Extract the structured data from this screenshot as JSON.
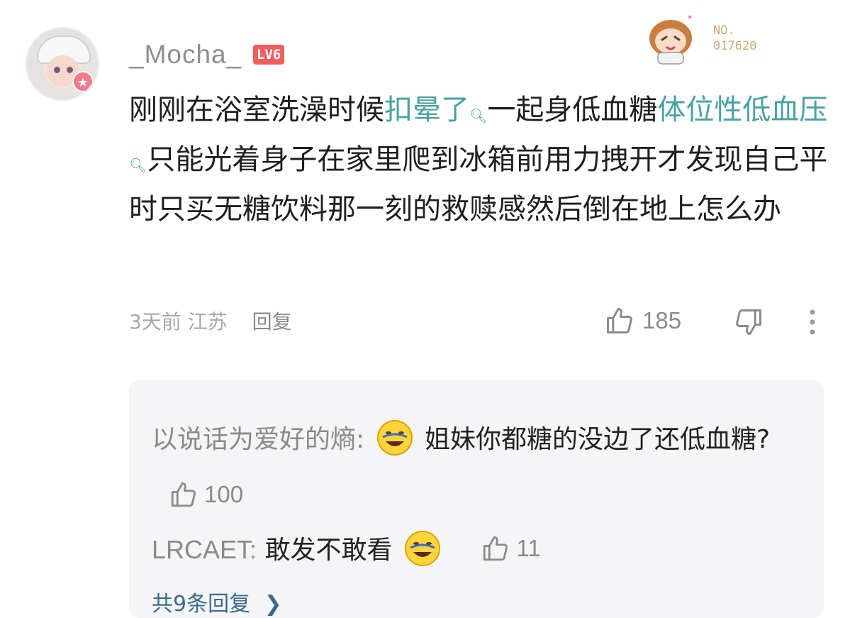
{
  "comment": {
    "username": "_Mocha_",
    "level": "LV6",
    "serial_line1": "NO.",
    "serial_line2": "017620",
    "text_part1": "刚刚在浴室洗澡时候",
    "keyword1": "扣晕了",
    "text_part2": "一起身低血糖",
    "keyword2": "体位性低血压",
    "text_part3": "只能光着身子在家里爬到冰箱前用力拽开才发现自己平时只买无糖饮料那一刻的救赎感然后倒在地上怎么办",
    "time": "3天前",
    "location": "江苏",
    "reply_label": "回复",
    "likes": "185"
  },
  "replies": [
    {
      "name": "以说话为爱好的熵:",
      "text_before": "",
      "text_after": "姐妹你都糖的没边了还低血糖?",
      "likes": "100"
    },
    {
      "name": "LRCAET:",
      "text_before": "敢发不敢看",
      "likes": "11"
    }
  ],
  "view_all": "共9条回复",
  "icons": {
    "avatar_badge": "★"
  },
  "colors": {
    "keyword": "#4aa0a3",
    "level_badge": "#f25d5d",
    "link": "#3c6a8f"
  }
}
